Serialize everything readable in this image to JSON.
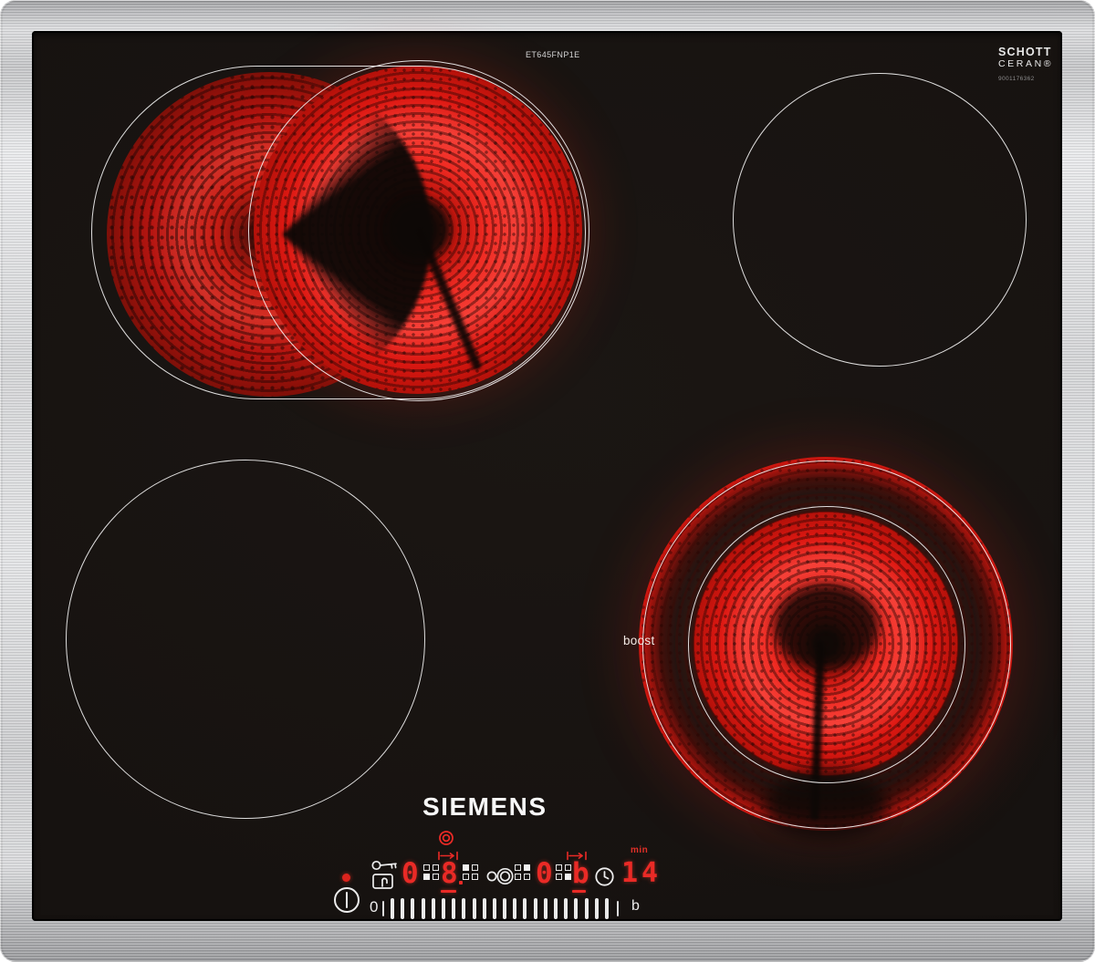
{
  "branding": {
    "logo": "SIEMENS",
    "model_number": "ET645FNP1E",
    "glass_brand_top": "SCHOTT",
    "glass_brand_bottom": "CERAN®",
    "glass_serial": "9001176362"
  },
  "zones": {
    "boost_label": "boost"
  },
  "control_panel": {
    "zone_display_left": "0",
    "zone_display_main": "8",
    "zone_display_right": "0",
    "zone_display_boost": "b",
    "timer_value": "14",
    "timer_unit_label": "min",
    "slider_min_label": "0",
    "slider_max_label": "b",
    "slider_tick_count": 22,
    "zone_indicators": [
      "bl",
      "tl",
      "tr",
      "br"
    ]
  },
  "icons": {
    "power": "power-icon",
    "child_lock": "key-touch-icon",
    "zone_position": "quad-position-icon",
    "heat_rings": "double-ring-icon",
    "timer_to_end": "bar-arrow-icon",
    "dual_zone": "circle-pair-icon",
    "timer": "clock-icon",
    "residual_heat": "red-dot-indicator"
  },
  "colors": {
    "display_red": "#ea2a26",
    "icon_white": "#ececec",
    "glass_black": "#17120f",
    "frame_steel": "#cfd0d2"
  }
}
